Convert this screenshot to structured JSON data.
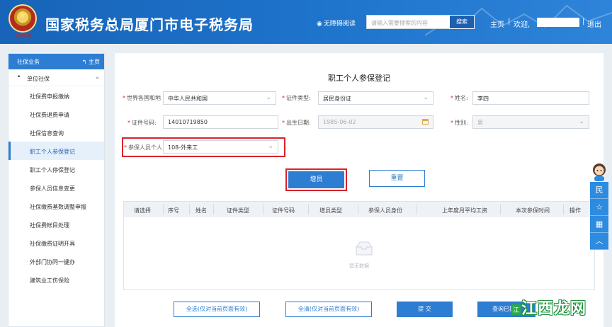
{
  "header": {
    "title": "国家税务总局厦门市电子税务局",
    "emblem_text": "中国税务",
    "accessibility": "无障碍阅读",
    "search_placeholder": "请输入需要搜索的内容",
    "search_button": "搜索",
    "home": "主页",
    "separator": "|",
    "welcome": "欢迎,",
    "logout": "退出"
  },
  "sidebar": {
    "header": "社保业务",
    "home_link": "主页",
    "group": "单位社保",
    "items": [
      "社保费申报缴纳",
      "社保费退费申请",
      "社保信息查询",
      "职工个人参保登记",
      "职工个人停保登记",
      "参保人员信息变更",
      "社保缴费基数调整申报",
      "社保费帐目处理",
      "社保缴费证明开具",
      "外部门协同一键办",
      "建筑业工伤保险"
    ],
    "active_index": 3
  },
  "form": {
    "title": "职工个人参保登记",
    "required_mark": "*",
    "country_label": "世界各国和地",
    "country_value": "中华人民共和国",
    "idtype_label": "证件类型:",
    "idtype_value": "居民身份证",
    "name_label": "姓名:",
    "name_value": "李四",
    "idno_label": "证件号码:",
    "idno_value": "14010719850",
    "birth_label": "出生日期:",
    "birth_value": "1985-06-02",
    "gender_label": "性别:",
    "gender_value": "男",
    "identity_label": "参保人员个人",
    "identity_value": "108-外来工"
  },
  "buttons": {
    "add": "增员",
    "reset": "重置"
  },
  "table": {
    "columns": [
      "请选择",
      "序号",
      "姓名",
      "证件类型",
      "证件号码",
      "增员类型",
      "参保人员身份",
      "上年度月平均工资",
      "本次参保时间",
      "操作"
    ],
    "empty_text": "暂无数据"
  },
  "footer": {
    "select_all": "全选(仅对当前页面有效)",
    "clear_all": "全清(仅对当前页面有效)",
    "submit": "提  交",
    "query_submitted": "查询已提交"
  },
  "float_bar": [
    "民",
    "☆",
    "▦",
    "︿"
  ],
  "watermark": {
    "text": "江西龙网",
    "tag": "江"
  },
  "colors": {
    "header": "#1764b8",
    "accent": "#2d7dd2",
    "highlight": "#d8232a",
    "required": "#e0261b"
  }
}
